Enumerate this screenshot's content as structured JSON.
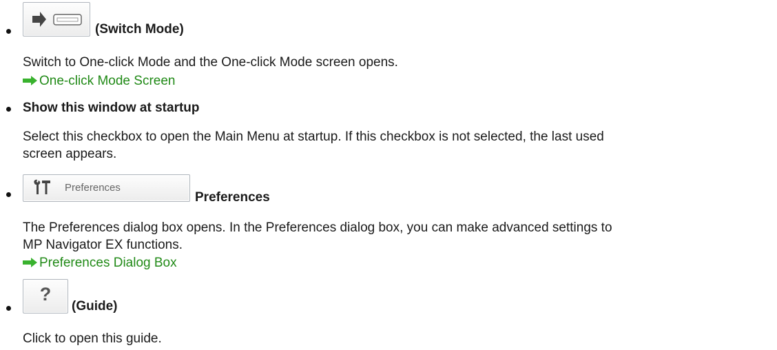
{
  "items": [
    {
      "title": "(Switch Mode)",
      "icon": "switch-mode-arrow-keyboard-icon",
      "description": "Switch to One-click Mode and the One-click Mode screen opens.",
      "link": "One-click Mode Screen"
    },
    {
      "title": "Show this window at startup",
      "description_line1": "Select this checkbox to open the Main Menu at startup. If this checkbox is not selected, the last used",
      "description_line2": "screen appears."
    },
    {
      "button_label": "Preferences",
      "icon": "tools-icon",
      "title": "Preferences",
      "description_line1": "The Preferences dialog box opens. In the Preferences dialog box, you can make advanced settings to",
      "description_line2": "MP Navigator EX functions.",
      "link": "Preferences Dialog Box"
    },
    {
      "button_label": "?",
      "title": "(Guide)",
      "description": "Click to open this guide."
    }
  ],
  "colors": {
    "link": "#218a17",
    "arrow": "#39b22e",
    "text": "#1a1a1a"
  }
}
